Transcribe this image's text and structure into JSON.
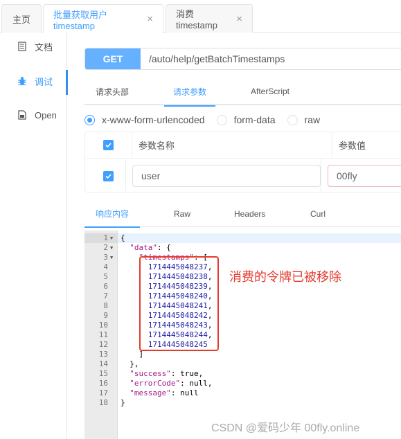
{
  "tabs": [
    {
      "label": "主页",
      "closable": false
    },
    {
      "label": "批量获取用户timestamp",
      "closable": true,
      "active": true
    },
    {
      "label": "消费timestamp",
      "closable": true
    }
  ],
  "close_glyph": "×",
  "sidebar": {
    "items": [
      {
        "label": "文档",
        "icon": "document-icon"
      },
      {
        "label": "调试",
        "icon": "bug-icon",
        "active": true
      },
      {
        "label": "Open",
        "icon": "file-icon"
      }
    ]
  },
  "request": {
    "method": "GET",
    "url": "/auto/help/getBatchTimestamps",
    "tabs": [
      "请求头部",
      "请求参数",
      "AfterScript"
    ],
    "active_tab": "请求参数",
    "body_types": [
      "x-www-form-urlencoded",
      "form-data",
      "raw"
    ],
    "selected_body_type": "x-www-form-urlencoded",
    "params_table": {
      "headers": [
        "参数名称",
        "参数值"
      ],
      "rows": [
        {
          "checked": true,
          "name": "user",
          "value": "00fly"
        }
      ]
    }
  },
  "response": {
    "tabs": [
      "响应内容",
      "Raw",
      "Headers",
      "Curl"
    ],
    "active_tab": "响应内容",
    "lines": [
      {
        "n": "1",
        "fold": true,
        "text": "{"
      },
      {
        "n": "2",
        "fold": true,
        "key": "\"data\"",
        "rest": ": {",
        "indent": "  "
      },
      {
        "n": "3",
        "fold": true,
        "key": "\"timestamps\"",
        "rest": ": [",
        "indent": "    "
      },
      {
        "n": "4",
        "num": "1714445048237",
        "rest": ",",
        "indent": "      "
      },
      {
        "n": "5",
        "num": "1714445048238",
        "rest": ",",
        "indent": "      "
      },
      {
        "n": "6",
        "num": "1714445048239",
        "rest": ",",
        "indent": "      "
      },
      {
        "n": "7",
        "num": "1714445048240",
        "rest": ",",
        "indent": "      "
      },
      {
        "n": "8",
        "num": "1714445048241",
        "rest": ",",
        "indent": "      "
      },
      {
        "n": "9",
        "num": "1714445048242",
        "rest": ",",
        "indent": "      "
      },
      {
        "n": "10",
        "num": "1714445048243",
        "rest": ",",
        "indent": "      "
      },
      {
        "n": "11",
        "num": "1714445048244",
        "rest": ",",
        "indent": "      "
      },
      {
        "n": "12",
        "num": "1714445048245",
        "rest": "",
        "indent": "      "
      },
      {
        "n": "13",
        "text": "    ]"
      },
      {
        "n": "14",
        "text": "  },"
      },
      {
        "n": "15",
        "key": "\"success\"",
        "rest": ": true,",
        "indent": "  "
      },
      {
        "n": "16",
        "key": "\"errorCode\"",
        "rest": ": null,",
        "indent": "  "
      },
      {
        "n": "17",
        "key": "\"message\"",
        "rest": ": null",
        "indent": "  "
      },
      {
        "n": "18",
        "text": "}"
      }
    ]
  },
  "annotation": "消费的令牌已被移除",
  "watermark": "CSDN @爱码少年 00fly.online",
  "colors": {
    "accent": "#409eff",
    "method_bg": "#66b1ff",
    "annotation_red": "#e53a2e",
    "json_key": "#a31a8a",
    "json_number": "#1a1aa6"
  }
}
